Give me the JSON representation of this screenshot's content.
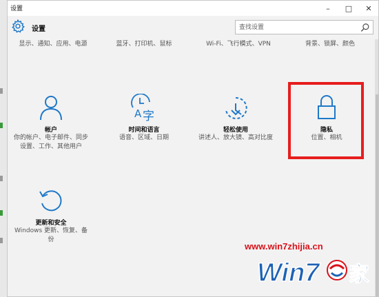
{
  "window": {
    "title": "设置",
    "controls": {
      "minimize": "–",
      "maximize": "□",
      "close": "✕"
    }
  },
  "header": {
    "app_name": "设置",
    "search_placeholder": "查找设置"
  },
  "top_row": [
    {
      "label": "显示、通知、应用、电源"
    },
    {
      "label": "蓝牙、打印机、鼠标"
    },
    {
      "label": "Wi-Fi、飞行模式、VPN"
    },
    {
      "label": "背景、锁屏、颜色"
    }
  ],
  "tiles": [
    {
      "id": "accounts",
      "icon": "person-icon",
      "title": "帐户",
      "desc": "你的帐户、电子邮件、同步设置、工作、其他用户"
    },
    {
      "id": "time-language",
      "icon": "clock-language-icon",
      "title": "时间和语言",
      "desc": "语音、区域、日期"
    },
    {
      "id": "ease-of-access",
      "icon": "ease-access-icon",
      "title": "轻松使用",
      "desc": "讲述人、放大镜、高对比度"
    },
    {
      "id": "privacy",
      "icon": "lock-icon",
      "title": "隐私",
      "desc": "位置、相机"
    },
    {
      "id": "update-security",
      "icon": "refresh-icon",
      "title": "更新和安全",
      "desc": "Windows 更新、恢复、备份"
    }
  ],
  "watermark": {
    "url": "www.win7zhijia.cn",
    "logo_text": "Win7",
    "logo_char": "家"
  },
  "colors": {
    "accent": "#1e78c8",
    "highlight": "#e61e1e",
    "watermark": "#d8121b",
    "logo_blue": "#1d62b5"
  }
}
